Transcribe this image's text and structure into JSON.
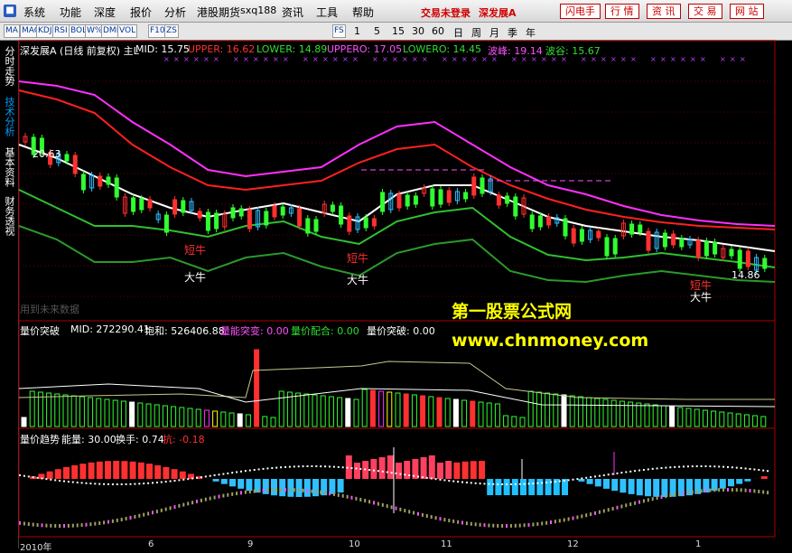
{
  "menu": {
    "items": [
      "系统",
      "功能",
      "深度",
      "报价",
      "分析",
      "港股期货",
      "sxq188",
      "资讯",
      "工具",
      "帮助"
    ],
    "trade_status": "交易未登录",
    "stock_name": "深发展A",
    "right_buttons": [
      "闪电手",
      "行 情",
      "资 讯",
      "交 易",
      "网 站"
    ]
  },
  "toolbar": {
    "icons": [
      "MA",
      "MACD",
      "KDJ",
      "RSI",
      "BOLL",
      "W%R",
      "DMI",
      "VOL",
      "F10",
      "ZS",
      "FS"
    ],
    "periods": [
      "1",
      "5",
      "15",
      "30",
      "60",
      "日",
      "周",
      "月",
      "季",
      "年"
    ]
  },
  "side_tabs": [
    "分时走势",
    "技术分析",
    "基本资料",
    "财务透视"
  ],
  "main_panel": {
    "title": "深发展A (日线 前复权) 主L",
    "mid": "MID: 15.75",
    "upper": "UPPER: 16.62",
    "lower": "LOWER: 14.89",
    "uppero": "UPPERO: 17.05",
    "lowero": "LOWERO: 14.45",
    "peak": "波峰: 19.14",
    "trough": "波谷: 15.67",
    "start_price": "20.63",
    "end_price": "14.86",
    "no_data": "用到未来数据",
    "annotations": [
      {
        "text": "短牛",
        "color": "#ff3030"
      },
      {
        "text": "大牛",
        "color": "#ffffff"
      },
      {
        "text": "短牛",
        "color": "#ff3030"
      },
      {
        "text": "大牛",
        "color": "#ffffff"
      },
      {
        "text": "短牛",
        "color": "#ff3030"
      },
      {
        "text": "大牛",
        "color": "#ffffff"
      }
    ]
  },
  "watermark": {
    "line1": "第一股票公式网",
    "line2": "www.chnmoney.com"
  },
  "vol_panel": {
    "title": "量价突破",
    "mid": "MID: 272290.41",
    "saturation": "饱和: 526406.88",
    "vol_break": "量能突变: 0.00",
    "price_match": "量价配合: 0.00",
    "price_break": "量价突破: 0.00"
  },
  "trend_panel": {
    "title": "量价趋势",
    "energy": "能量: 30.00",
    "turnover": "换手: 0.74",
    "resist": "抗: -0.18"
  },
  "x_axis": [
    "2010年",
    "6",
    "9",
    "10",
    "11",
    "12",
    "1"
  ],
  "colors": {
    "upper": "#ff2020",
    "mid": "#ffffff",
    "lower": "#30c030",
    "outer": "#ff30ff",
    "bg": "#000000"
  }
}
